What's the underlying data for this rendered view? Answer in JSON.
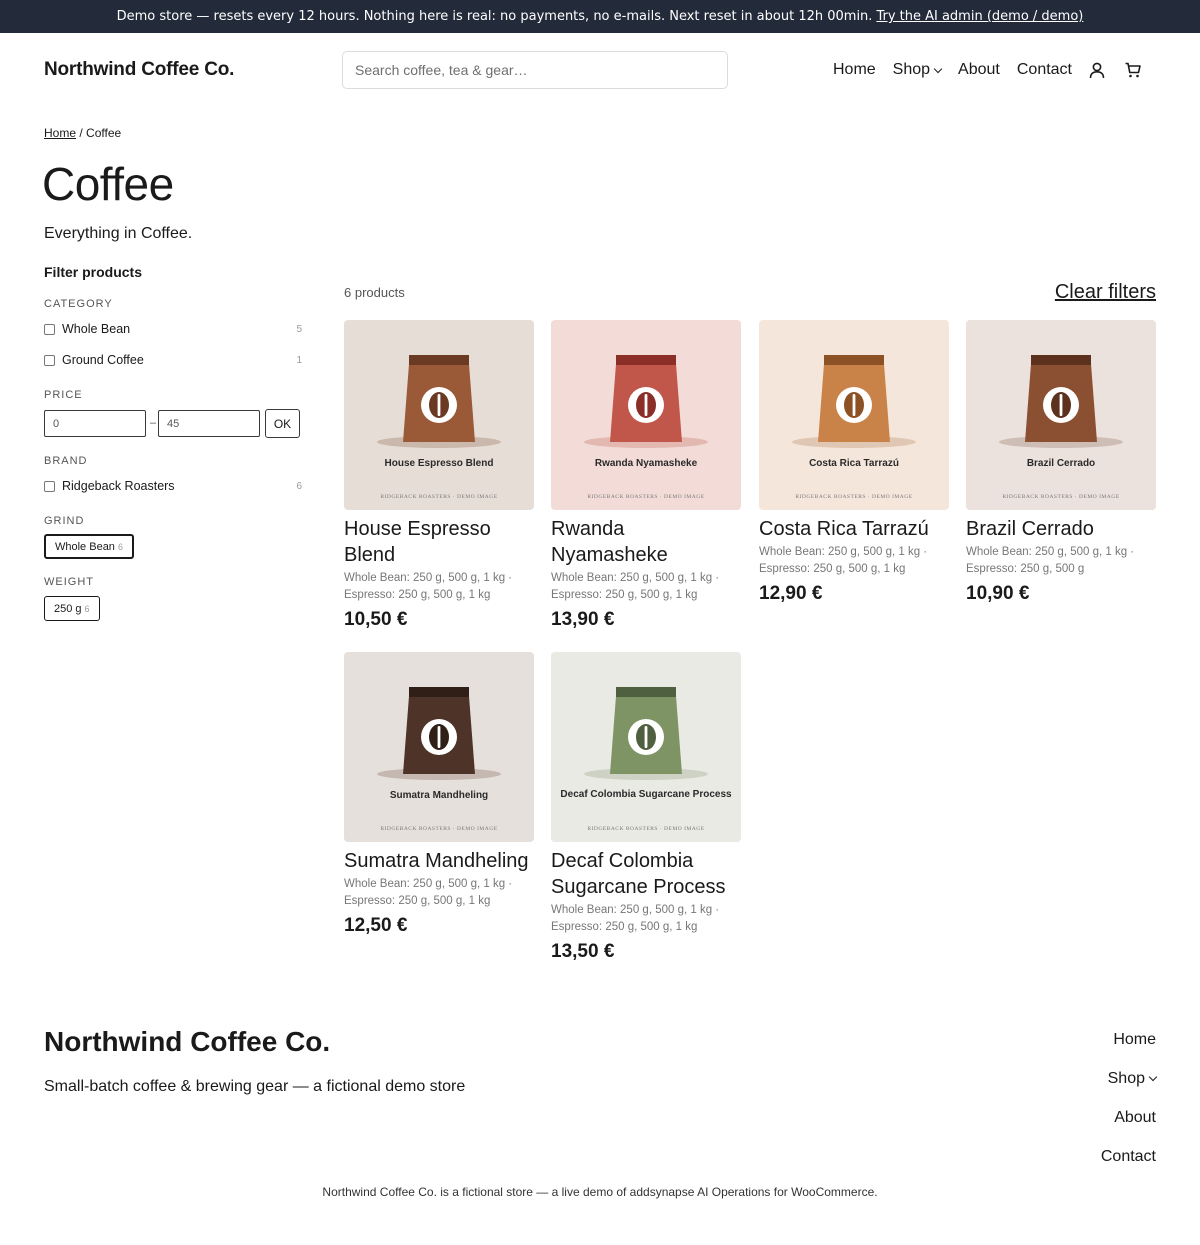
{
  "banner": {
    "text": "Demo store — resets every 12 hours. Nothing here is real: no payments, no e-mails. Next reset in about 12h 00min.",
    "link": "Try the AI admin (demo / demo)"
  },
  "header": {
    "logo": "Northwind Coffee Co.",
    "search_placeholder": "Search coffee, tea & gear…",
    "nav": [
      "Home",
      "Shop",
      "About",
      "Contact"
    ]
  },
  "breadcrumb": {
    "home": "Home",
    "separator": "/",
    "current": "Coffee"
  },
  "page": {
    "title": "Coffee",
    "description": "Everything in Coffee."
  },
  "filters": {
    "title": "Filter products",
    "category": {
      "label": "CATEGORY",
      "options": [
        {
          "label": "Whole Bean",
          "count": "5",
          "checked": false
        },
        {
          "label": "Ground Coffee",
          "count": "1",
          "checked": false
        }
      ]
    },
    "price": {
      "label": "PRICE",
      "min": "0",
      "dash": "–",
      "max": "45",
      "button": "OK"
    },
    "brand": {
      "label": "BRAND",
      "options": [
        {
          "label": "Ridgeback Roasters",
          "count": "6",
          "checked": false
        }
      ]
    },
    "grind": {
      "label": "GRIND",
      "chip": "Whole Bean",
      "count": "6",
      "active": true
    },
    "weight": {
      "label": "WEIGHT",
      "chip": "250 g",
      "count": "6",
      "active": false
    }
  },
  "results": {
    "count": "6 products",
    "clear": "Clear filters"
  },
  "products": [
    {
      "name": "House Espresso Blend",
      "attr1": "Whole Bean: 250 g, 500 g, 1 kg ·",
      "attr2": "Espresso: 250 g, 500 g, 1 kg",
      "price": "10,50 €",
      "image_label": "House Espresso Blend",
      "image_footer": "RIDGEBACK ROASTERS · DEMO IMAGE",
      "bg": "#e7ddd7",
      "bag": "#9a5a38",
      "band": "#6b3a22",
      "shadow": "#c9b8ab"
    },
    {
      "name": "Rwanda Nyamasheke",
      "attr1": "Whole Bean: 250 g, 500 g, 1 kg ·",
      "attr2": "Espresso: 250 g, 500 g, 1 kg",
      "price": "13,90 €",
      "image_label": "Rwanda Nyamasheke",
      "image_footer": "RIDGEBACK ROASTERS · DEMO IMAGE",
      "bg": "#f3dcd8",
      "bag": "#c1564a",
      "band": "#8a2e27",
      "shadow": "#e2b8b1"
    },
    {
      "name": "Costa Rica Tarrazú",
      "attr1": "Whole Bean: 250 g, 500 g, 1 kg ·",
      "attr2": "Espresso: 250 g, 500 g, 1 kg",
      "price": "12,90 €",
      "image_label": "Costa Rica Tarrazú",
      "image_footer": "RIDGEBACK ROASTERS · DEMO IMAGE",
      "bg": "#f5e6dc",
      "bag": "#c98248",
      "band": "#8c5226",
      "shadow": "#e0c7b3"
    },
    {
      "name": "Brazil Cerrado",
      "attr1": "Whole Bean: 250 g, 500 g, 1 kg ·",
      "attr2": "Espresso: 250 g, 500 g",
      "price": "10,90 €",
      "image_label": "Brazil Cerrado",
      "image_footer": "RIDGEBACK ROASTERS · DEMO IMAGE",
      "bg": "#ebe1dd",
      "bag": "#8b5032",
      "band": "#5c311d",
      "shadow": "#cdbdb4"
    },
    {
      "name": "Sumatra Mandheling",
      "attr1": "Whole Bean: 250 g, 500 g, 1 kg ·",
      "attr2": "Espresso: 250 g, 500 g, 1 kg",
      "price": "12,50 €",
      "image_label": "Sumatra Mandheling",
      "image_footer": "RIDGEBACK ROASTERS · DEMO IMAGE",
      "bg": "#e6e0dc",
      "bag": "#4e3428",
      "band": "#2f1f17",
      "shadow": "#c4b8b1"
    },
    {
      "name": "Decaf Colombia Sugarcane Process",
      "attr1": "Whole Bean: 250 g, 500 g, 1 kg ·",
      "attr2": "Espresso: 250 g, 500 g, 1 kg",
      "price": "13,50 €",
      "image_label": "Decaf Colombia Sugarcane Process",
      "image_footer": "RIDGEBACK ROASTERS · DEMO IMAGE",
      "bg": "#e9eae4",
      "bag": "#7f9464",
      "band": "#4f6040",
      "shadow": "#cdd2c4"
    }
  ],
  "footer": {
    "logo": "Northwind Coffee Co.",
    "tagline": "Small-batch coffee & brewing gear — a fictional demo store",
    "nav": [
      "Home",
      "Shop",
      "About",
      "Contact"
    ],
    "note": "Northwind Coffee Co. is a fictional store — a live demo of addsynapse AI Operations for WooCommerce."
  },
  "colors": {
    "banner_bg": "#232a3a",
    "text": "#1a1a1a",
    "muted": "#777777"
  },
  "icons": {
    "account": "user-icon",
    "cart": "cart-icon",
    "submenu": "chevron-down-icon"
  }
}
